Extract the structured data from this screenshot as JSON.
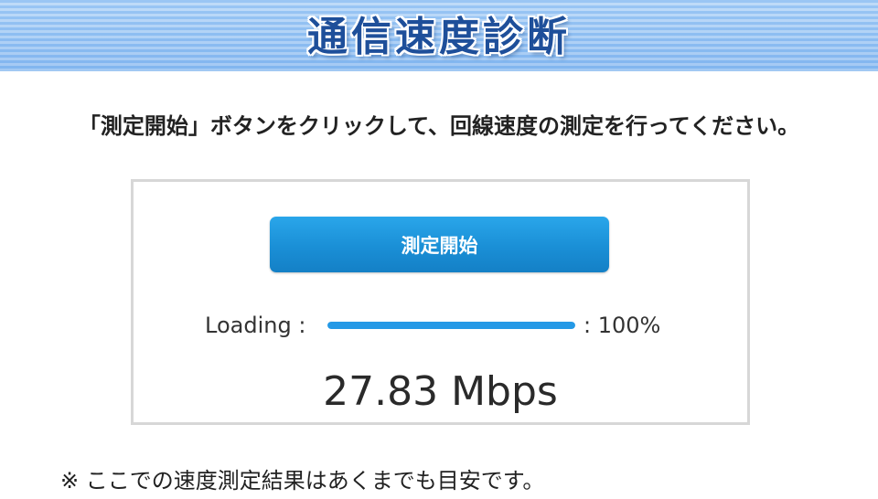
{
  "header": {
    "title": "通信速度診断"
  },
  "instruction": "「測定開始」ボタンをクリックして、回線速度の測定を行ってください。",
  "panel": {
    "start_button_label": "測定開始",
    "loading_label": "Loading :",
    "progress_fraction": 1.0,
    "progress_text": ": 100%",
    "speed_result": "27.83 Mbps"
  },
  "note": "※ ここでの速度測定結果はあくまでも目安です。",
  "colors": {
    "banner_stripe_dark": "#8fc0f3",
    "banner_stripe_light": "#b9d8f8",
    "title_text": "#1e4f9a",
    "button_blue": "#1a8fd6",
    "progress_blue": "#2499e6",
    "panel_border": "#d7d7d7"
  }
}
